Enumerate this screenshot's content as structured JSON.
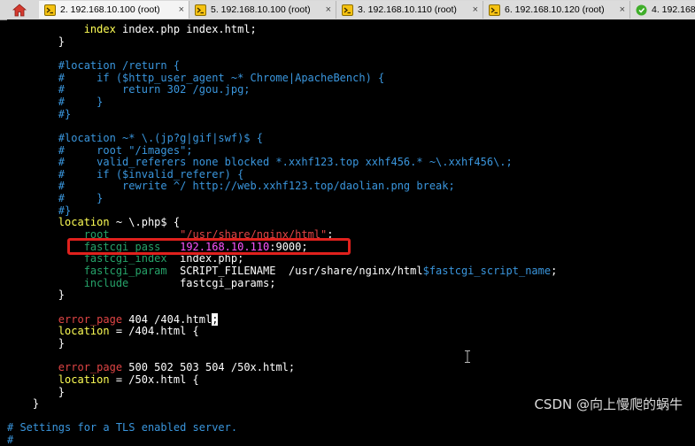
{
  "tabs": [
    {
      "label": "2. 192.168.10.100 (root)",
      "icon": "terminal-session-icon",
      "close": "×",
      "active": true
    },
    {
      "label": "5. 192.168.10.100 (root)",
      "icon": "terminal-session-icon",
      "close": "×",
      "active": false
    },
    {
      "label": "3. 192.168.10.110 (root)",
      "icon": "terminal-session-icon",
      "close": "×",
      "active": false
    },
    {
      "label": "6. 192.168.10.120 (root)",
      "icon": "terminal-session-icon",
      "close": "×",
      "active": false
    },
    {
      "label": "4. 192.168.0",
      "icon": "green-session-icon",
      "close": "",
      "active": false
    }
  ],
  "terminal": {
    "lines": [
      [
        {
          "t": "            ",
          "c": "w"
        },
        {
          "t": "index",
          "c": "y"
        },
        {
          "t": " index.php index.html;",
          "c": "w"
        }
      ],
      [
        {
          "t": "        }",
          "c": "w"
        }
      ],
      [],
      [
        {
          "t": "        #location /return {",
          "c": "c"
        }
      ],
      [
        {
          "t": "        #     if ($http_user_agent ~* Chrome|ApacheBench) {",
          "c": "c"
        }
      ],
      [
        {
          "t": "        #         return 302 /gou.jpg;",
          "c": "c"
        }
      ],
      [
        {
          "t": "        #     }",
          "c": "c"
        }
      ],
      [
        {
          "t": "        #}",
          "c": "c"
        }
      ],
      [],
      [
        {
          "t": "        #location ~* \\.(jp?g|gif|swf)$ {",
          "c": "c"
        }
      ],
      [
        {
          "t": "        #     root \"/images\";",
          "c": "c"
        }
      ],
      [
        {
          "t": "        #     valid_referers none blocked *.xxhf123.top xxhf456.* ~\\.xxhf456\\.;",
          "c": "c"
        }
      ],
      [
        {
          "t": "        #     if ($invalid_referer) {",
          "c": "c"
        }
      ],
      [
        {
          "t": "        #         rewrite ^/ http://web.xxhf123.top/daolian.png break;",
          "c": "c"
        }
      ],
      [
        {
          "t": "        #     }",
          "c": "c"
        }
      ],
      [
        {
          "t": "        #}",
          "c": "c"
        }
      ],
      [
        {
          "t": "        ",
          "c": "w"
        },
        {
          "t": "location",
          "c": "y"
        },
        {
          "t": " ~ \\.php$ {",
          "c": "w"
        }
      ],
      [
        {
          "t": "            ",
          "c": "w"
        },
        {
          "t": "root",
          "c": "g"
        },
        {
          "t": "           ",
          "c": "w"
        },
        {
          "t": "\"/usr/share/nginx/html\"",
          "c": "r"
        },
        {
          "t": ";",
          "c": "w"
        }
      ],
      [
        {
          "t": "            ",
          "c": "w"
        },
        {
          "t": "fastcgi_pass",
          "c": "g"
        },
        {
          "t": "   ",
          "c": "w"
        },
        {
          "t": "192.168.10.110",
          "c": "m"
        },
        {
          "t": ":9000;",
          "c": "w"
        }
      ],
      [
        {
          "t": "            ",
          "c": "w"
        },
        {
          "t": "fastcgi_index",
          "c": "g"
        },
        {
          "t": "  index.php;",
          "c": "w"
        }
      ],
      [
        {
          "t": "            ",
          "c": "w"
        },
        {
          "t": "fastcgi_param",
          "c": "g"
        },
        {
          "t": "  SCRIPT_FILENAME  /usr/share/nginx/html",
          "c": "w"
        },
        {
          "t": "$fastcgi_script_name",
          "c": "c"
        },
        {
          "t": ";",
          "c": "w"
        }
      ],
      [
        {
          "t": "            ",
          "c": "w"
        },
        {
          "t": "include",
          "c": "g"
        },
        {
          "t": "        fastcgi_params;",
          "c": "w"
        }
      ],
      [
        {
          "t": "        }",
          "c": "w"
        }
      ],
      [],
      [
        {
          "t": "        ",
          "c": "w"
        },
        {
          "t": "error_page",
          "c": "r"
        },
        {
          "t": " 404 /404.html",
          "c": "w"
        },
        {
          "t": ";",
          "c": "cursor"
        }
      ],
      [
        {
          "t": "        ",
          "c": "w"
        },
        {
          "t": "location",
          "c": "y"
        },
        {
          "t": " = /404.html {",
          "c": "w"
        }
      ],
      [
        {
          "t": "        }",
          "c": "w"
        }
      ],
      [],
      [
        {
          "t": "        ",
          "c": "w"
        },
        {
          "t": "error_page",
          "c": "r"
        },
        {
          "t": " 500 502 503 504 /50x.html;",
          "c": "w"
        }
      ],
      [
        {
          "t": "        ",
          "c": "w"
        },
        {
          "t": "location",
          "c": "y"
        },
        {
          "t": " = /50x.html {",
          "c": "w"
        }
      ],
      [
        {
          "t": "        }",
          "c": "w"
        }
      ],
      [
        {
          "t": "    }",
          "c": "w"
        }
      ],
      [],
      [
        {
          "t": "# Settings for a TLS enabled server.",
          "c": "c"
        }
      ],
      [
        {
          "t": "#",
          "c": "c"
        }
      ]
    ]
  },
  "watermark": "CSDN @向上慢爬的蜗牛",
  "colors": {
    "keyword": "#ffff55",
    "directive": "#26a269",
    "comment": "#3a96dd",
    "string": "#e04545",
    "ip": "#ff55ff",
    "highlight_box": "#e0211d"
  }
}
